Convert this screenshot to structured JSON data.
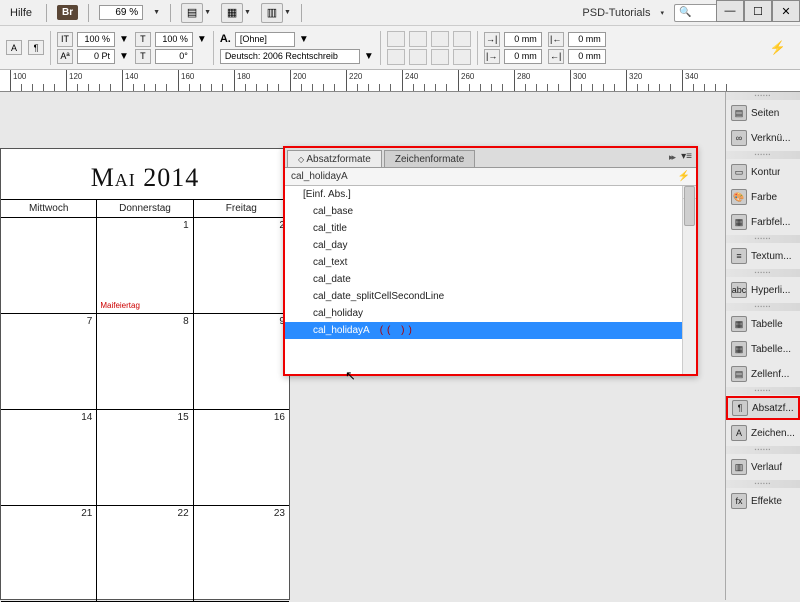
{
  "menu": {
    "help": "Hilfe",
    "bridge": "Br",
    "zoom": "69 %",
    "link": "PSD-Tutorials"
  },
  "window_controls": {
    "min": "—",
    "max": "☐",
    "close": "✕"
  },
  "control": {
    "size1": "100 %",
    "leading": "0 Pt",
    "size2": "100 %",
    "rot": "0°",
    "style_none": "[Ohne]",
    "lang": "Deutsch: 2006 Rechtschreib",
    "mm1": "0 mm",
    "mm2": "0 mm"
  },
  "ruler": {
    "ticks": [
      "100",
      "120",
      "140",
      "160",
      "180",
      "200",
      "220",
      "240",
      "260",
      "280",
      "300",
      "320",
      "340"
    ]
  },
  "calendar": {
    "title": "Mai 2014",
    "days": [
      "Mittwoch",
      "Donnerstag",
      "Freitag"
    ],
    "rows": [
      {
        "nums": [
          "",
          "1",
          "2"
        ],
        "holiday": {
          "col": 1,
          "text": "Maifeiertag"
        }
      },
      {
        "nums": [
          "7",
          "8",
          "9"
        ]
      },
      {
        "nums": [
          "14",
          "15",
          "16"
        ]
      },
      {
        "nums": [
          "21",
          "22",
          "23"
        ]
      }
    ]
  },
  "panel": {
    "tabs": {
      "para": "Absatzformate",
      "char": "Zeichenformate"
    },
    "filter": "cal_holidayA",
    "items": [
      "[Einf. Abs.]",
      "cal_base",
      "cal_title",
      "cal_day",
      "cal_text",
      "cal_date",
      "cal_date_splitCellSecondLine",
      "cal_holiday",
      "cal_holidayA"
    ],
    "selected_index": 8,
    "paren": "((  ))"
  },
  "dock": {
    "groups": [
      {
        "items": [
          {
            "icon": "▤",
            "label": "Seiten"
          },
          {
            "icon": "∞",
            "label": "Verknü..."
          }
        ]
      },
      {
        "items": [
          {
            "icon": "▭",
            "label": "Kontur"
          },
          {
            "icon": "🎨",
            "label": "Farbe"
          },
          {
            "icon": "▦",
            "label": "Farbfel..."
          }
        ]
      },
      {
        "items": [
          {
            "icon": "≡",
            "label": "Textum..."
          }
        ]
      },
      {
        "items": [
          {
            "icon": "abc",
            "label": "Hyperli..."
          }
        ]
      },
      {
        "items": [
          {
            "icon": "▦",
            "label": "Tabelle"
          },
          {
            "icon": "▦",
            "label": "Tabelle..."
          },
          {
            "icon": "▤",
            "label": "Zellenf..."
          }
        ]
      },
      {
        "items": [
          {
            "icon": "¶",
            "label": "Absatzf...",
            "selected": true
          },
          {
            "icon": "A",
            "label": "Zeichen..."
          }
        ]
      },
      {
        "items": [
          {
            "icon": "▥",
            "label": "Verlauf"
          }
        ]
      },
      {
        "items": [
          {
            "icon": "fx",
            "label": "Effekte"
          }
        ]
      }
    ]
  }
}
